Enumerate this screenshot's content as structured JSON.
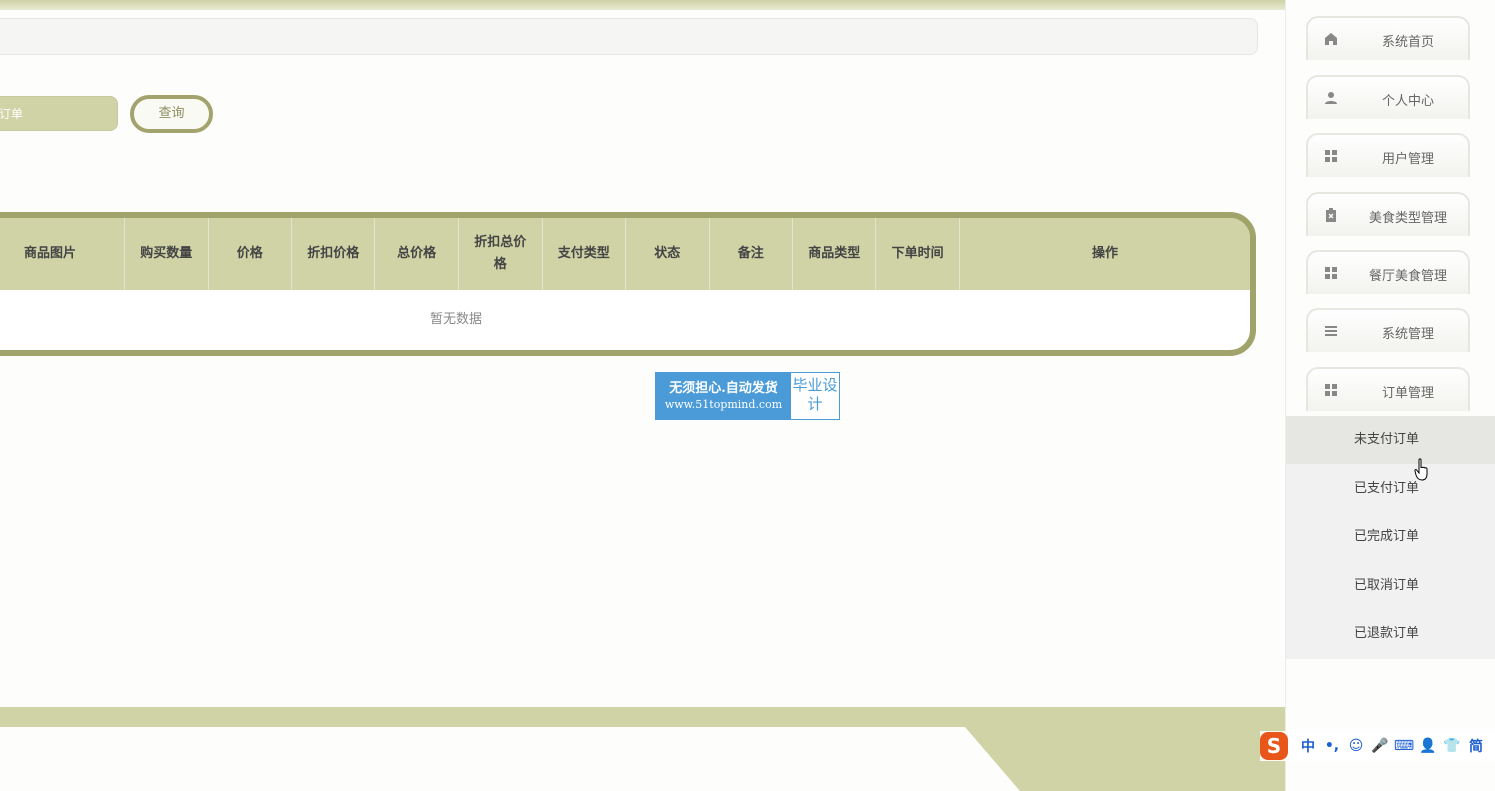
{
  "search": {
    "placeholder": "订单"
  },
  "query_button": "查询",
  "table": {
    "columns": [
      "商品图片",
      "购买数量",
      "价格",
      "折扣价格",
      "总价格",
      "折扣总价格",
      "支付类型",
      "状态",
      "备注",
      "商品类型",
      "下单时间",
      "操作"
    ],
    "empty_text": "暂无数据"
  },
  "watermark": {
    "line1": "无须担心.自动发货",
    "line2": "www.51topmind.com",
    "right": "毕业设计"
  },
  "sidebar": {
    "items": [
      {
        "label": "系统首页",
        "icon": "home-icon"
      },
      {
        "label": "个人中心",
        "icon": "user-icon"
      },
      {
        "label": "用户管理",
        "icon": "grid-icon"
      },
      {
        "label": "美食类型管理",
        "icon": "clipboard-icon"
      },
      {
        "label": "餐厅美食管理",
        "icon": "grid-icon"
      },
      {
        "label": "系统管理",
        "icon": "menu-icon"
      },
      {
        "label": "订单管理",
        "icon": "grid-icon"
      }
    ],
    "submenu": [
      "未支付订单",
      "已支付订单",
      "已完成订单",
      "已取消订单",
      "已退款订单"
    ],
    "active_submenu": "未支付订单"
  },
  "ime": {
    "logo": "S",
    "items": [
      "中",
      "•,",
      "☺",
      "🎤",
      "⌨",
      "👤",
      "👕",
      "简"
    ]
  },
  "colors": {
    "accent": "#cfd3a6",
    "accent_dark": "#a0a36a",
    "watermark_blue": "#4a9bd8"
  }
}
